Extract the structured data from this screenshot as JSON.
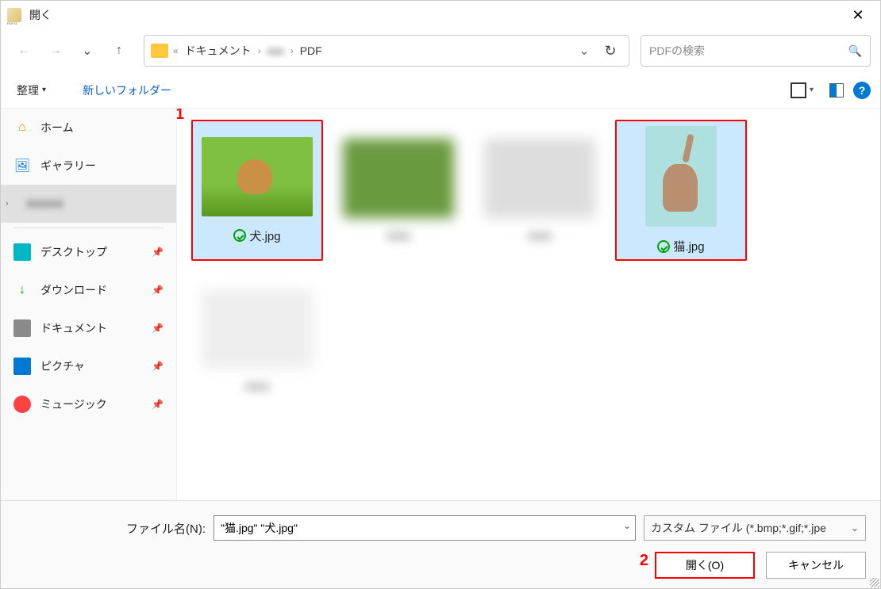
{
  "window": {
    "title": "開く"
  },
  "nav": {
    "crumb1": "ドキュメント",
    "crumb2": "xxx",
    "crumb3": "PDF"
  },
  "search": {
    "placeholder": "PDFの検索"
  },
  "toolbar": {
    "organize": "整理",
    "newfolder": "新しいフォルダー"
  },
  "sidebar": {
    "home": "ホーム",
    "gallery": "ギャラリー",
    "blurred": "XXXXX",
    "desktop": "デスクトップ",
    "downloads": "ダウンロード",
    "documents": "ドキュメント",
    "pictures": "ピクチャ",
    "music": "ミュージック"
  },
  "files": {
    "f1": "犬.jpg",
    "f2": "猫.jpg"
  },
  "annotations": {
    "a1": "1",
    "a2": "2"
  },
  "bottom": {
    "filename_label": "ファイル名(N):",
    "filename_value": "\"猫.jpg\" \"犬.jpg\"",
    "filetype": "カスタム ファイル (*.bmp;*.gif;*.jpe",
    "open": "開く(O)",
    "cancel": "キャンセル"
  }
}
